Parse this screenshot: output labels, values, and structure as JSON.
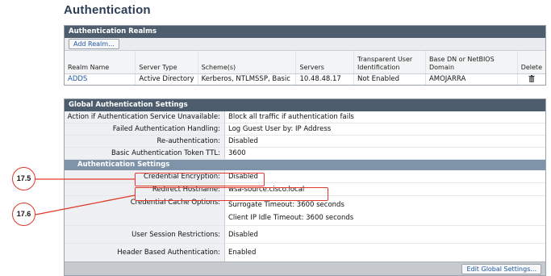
{
  "page_title": "Authentication",
  "realms": {
    "heading": "Authentication Realms",
    "add_button": "Add Realm...",
    "columns": [
      "Realm Name",
      "Server Type",
      "Scheme(s)",
      "Servers",
      "Transparent User Identification",
      "Base DN or NetBIOS Domain",
      "Delete"
    ],
    "rows": [
      {
        "realm_name": "ADDS",
        "server_type": "Active Directory",
        "schemes": "Kerberos, NTLMSSP, Basic",
        "servers": "10.48.48.17",
        "transparent": "Not Enabled",
        "base_dn": "AMOJARRA",
        "delete_icon": "trash-icon"
      }
    ]
  },
  "global": {
    "heading": "Global Authentication Settings",
    "rows": [
      {
        "label": "Action if Authentication Service Unavailable:",
        "value": "Block all traffic if authentication fails"
      },
      {
        "label": "Failed Authentication Handling:",
        "value": "Log Guest User by: IP Address"
      },
      {
        "label": "Re-authentication:",
        "value": "Disabled"
      },
      {
        "label": "Basic Authentication Token TTL:",
        "value": "3600"
      }
    ],
    "subheading": "Authentication Settings",
    "auth_rows": {
      "credential_encryption": {
        "label": "Credential Encryption:",
        "value": "Disabled"
      },
      "redirect_hostname": {
        "label": "Redirect Hostname:",
        "value": "wsa-source.cisco.local"
      },
      "credential_cache": {
        "label": "Credential Cache Options:",
        "surrogate": "Surrogate Timeout: 3600 seconds",
        "client_ip": "Client IP Idle Timeout: 3600 seconds"
      },
      "user_session": {
        "label": "User Session Restrictions:",
        "value": "Disabled"
      },
      "header_based": {
        "label": "Header Based Authentication:",
        "value": "Enabled"
      }
    },
    "edit_button": "Edit Global Settings..."
  },
  "callouts": [
    "17.5",
    "17.6"
  ],
  "colors": {
    "highlight": "#e03a2a",
    "panel_header": "#4d5d6e",
    "subheader": "#7f93a9",
    "link": "#1f5aa6"
  }
}
